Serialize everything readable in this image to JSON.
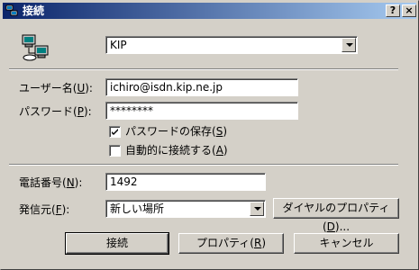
{
  "window": {
    "title": "接続"
  },
  "titlebar": {
    "help_label": "?",
    "close_label": "×"
  },
  "connection": {
    "selected": "KIP"
  },
  "username": {
    "label": "ユーザー名(",
    "accel": "U",
    "suffix": "):",
    "value": "ichiro@isdn.kip.ne.jp"
  },
  "password": {
    "label": "パスワード(",
    "accel": "P",
    "suffix": "):",
    "value": "********"
  },
  "save_password": {
    "label": "パスワードの保存(",
    "accel": "S",
    "suffix": ")",
    "checked": true
  },
  "auto_connect": {
    "label": "自動的に接続する(",
    "accel": "A",
    "suffix": ")",
    "checked": false
  },
  "phone": {
    "label": "電話番号(",
    "accel": "N",
    "suffix": "):",
    "value": "1492"
  },
  "dial_from": {
    "label": "発信元(",
    "accel": "F",
    "suffix": "):",
    "value": "新しい場所"
  },
  "dial_props_button": {
    "label": "ダイヤルのプロパティ(",
    "accel": "D",
    "suffix": ")..."
  },
  "buttons": {
    "connect": "接続",
    "properties": {
      "label": "プロパティ(",
      "accel": "R",
      "suffix": ")"
    },
    "cancel": "キャンセル"
  }
}
